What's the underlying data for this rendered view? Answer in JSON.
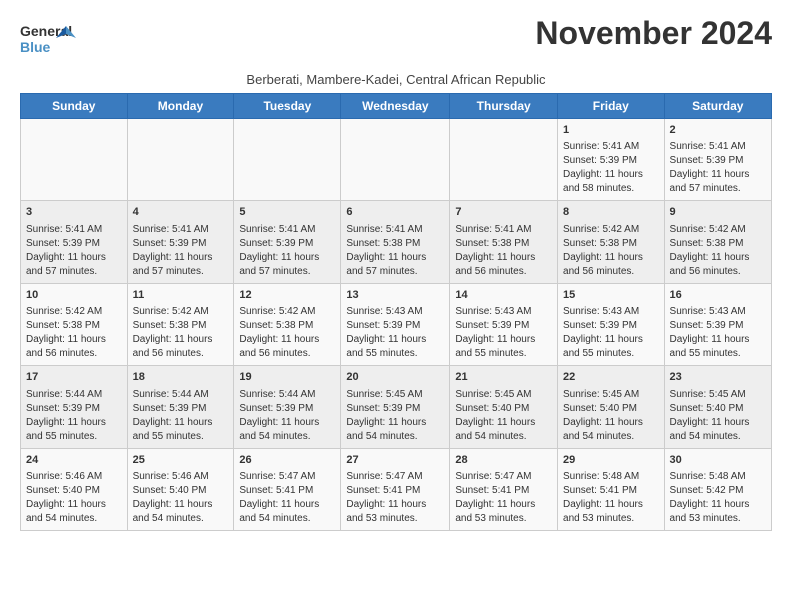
{
  "header": {
    "logo_line1": "General",
    "logo_line2": "Blue",
    "month": "November 2024",
    "subtitle": "Berberati, Mambere-Kadei, Central African Republic"
  },
  "weekdays": [
    "Sunday",
    "Monday",
    "Tuesday",
    "Wednesday",
    "Thursday",
    "Friday",
    "Saturday"
  ],
  "rows": [
    [
      {
        "day": "",
        "text": ""
      },
      {
        "day": "",
        "text": ""
      },
      {
        "day": "",
        "text": ""
      },
      {
        "day": "",
        "text": ""
      },
      {
        "day": "",
        "text": ""
      },
      {
        "day": "1",
        "text": "Sunrise: 5:41 AM\nSunset: 5:39 PM\nDaylight: 11 hours and 58 minutes."
      },
      {
        "day": "2",
        "text": "Sunrise: 5:41 AM\nSunset: 5:39 PM\nDaylight: 11 hours and 57 minutes."
      }
    ],
    [
      {
        "day": "3",
        "text": "Sunrise: 5:41 AM\nSunset: 5:39 PM\nDaylight: 11 hours and 57 minutes."
      },
      {
        "day": "4",
        "text": "Sunrise: 5:41 AM\nSunset: 5:39 PM\nDaylight: 11 hours and 57 minutes."
      },
      {
        "day": "5",
        "text": "Sunrise: 5:41 AM\nSunset: 5:39 PM\nDaylight: 11 hours and 57 minutes."
      },
      {
        "day": "6",
        "text": "Sunrise: 5:41 AM\nSunset: 5:38 PM\nDaylight: 11 hours and 57 minutes."
      },
      {
        "day": "7",
        "text": "Sunrise: 5:41 AM\nSunset: 5:38 PM\nDaylight: 11 hours and 56 minutes."
      },
      {
        "day": "8",
        "text": "Sunrise: 5:42 AM\nSunset: 5:38 PM\nDaylight: 11 hours and 56 minutes."
      },
      {
        "day": "9",
        "text": "Sunrise: 5:42 AM\nSunset: 5:38 PM\nDaylight: 11 hours and 56 minutes."
      }
    ],
    [
      {
        "day": "10",
        "text": "Sunrise: 5:42 AM\nSunset: 5:38 PM\nDaylight: 11 hours and 56 minutes."
      },
      {
        "day": "11",
        "text": "Sunrise: 5:42 AM\nSunset: 5:38 PM\nDaylight: 11 hours and 56 minutes."
      },
      {
        "day": "12",
        "text": "Sunrise: 5:42 AM\nSunset: 5:38 PM\nDaylight: 11 hours and 56 minutes."
      },
      {
        "day": "13",
        "text": "Sunrise: 5:43 AM\nSunset: 5:39 PM\nDaylight: 11 hours and 55 minutes."
      },
      {
        "day": "14",
        "text": "Sunrise: 5:43 AM\nSunset: 5:39 PM\nDaylight: 11 hours and 55 minutes."
      },
      {
        "day": "15",
        "text": "Sunrise: 5:43 AM\nSunset: 5:39 PM\nDaylight: 11 hours and 55 minutes."
      },
      {
        "day": "16",
        "text": "Sunrise: 5:43 AM\nSunset: 5:39 PM\nDaylight: 11 hours and 55 minutes."
      }
    ],
    [
      {
        "day": "17",
        "text": "Sunrise: 5:44 AM\nSunset: 5:39 PM\nDaylight: 11 hours and 55 minutes."
      },
      {
        "day": "18",
        "text": "Sunrise: 5:44 AM\nSunset: 5:39 PM\nDaylight: 11 hours and 55 minutes."
      },
      {
        "day": "19",
        "text": "Sunrise: 5:44 AM\nSunset: 5:39 PM\nDaylight: 11 hours and 54 minutes."
      },
      {
        "day": "20",
        "text": "Sunrise: 5:45 AM\nSunset: 5:39 PM\nDaylight: 11 hours and 54 minutes."
      },
      {
        "day": "21",
        "text": "Sunrise: 5:45 AM\nSunset: 5:40 PM\nDaylight: 11 hours and 54 minutes."
      },
      {
        "day": "22",
        "text": "Sunrise: 5:45 AM\nSunset: 5:40 PM\nDaylight: 11 hours and 54 minutes."
      },
      {
        "day": "23",
        "text": "Sunrise: 5:45 AM\nSunset: 5:40 PM\nDaylight: 11 hours and 54 minutes."
      }
    ],
    [
      {
        "day": "24",
        "text": "Sunrise: 5:46 AM\nSunset: 5:40 PM\nDaylight: 11 hours and 54 minutes."
      },
      {
        "day": "25",
        "text": "Sunrise: 5:46 AM\nSunset: 5:40 PM\nDaylight: 11 hours and 54 minutes."
      },
      {
        "day": "26",
        "text": "Sunrise: 5:47 AM\nSunset: 5:41 PM\nDaylight: 11 hours and 54 minutes."
      },
      {
        "day": "27",
        "text": "Sunrise: 5:47 AM\nSunset: 5:41 PM\nDaylight: 11 hours and 53 minutes."
      },
      {
        "day": "28",
        "text": "Sunrise: 5:47 AM\nSunset: 5:41 PM\nDaylight: 11 hours and 53 minutes."
      },
      {
        "day": "29",
        "text": "Sunrise: 5:48 AM\nSunset: 5:41 PM\nDaylight: 11 hours and 53 minutes."
      },
      {
        "day": "30",
        "text": "Sunrise: 5:48 AM\nSunset: 5:42 PM\nDaylight: 11 hours and 53 minutes."
      }
    ]
  ]
}
